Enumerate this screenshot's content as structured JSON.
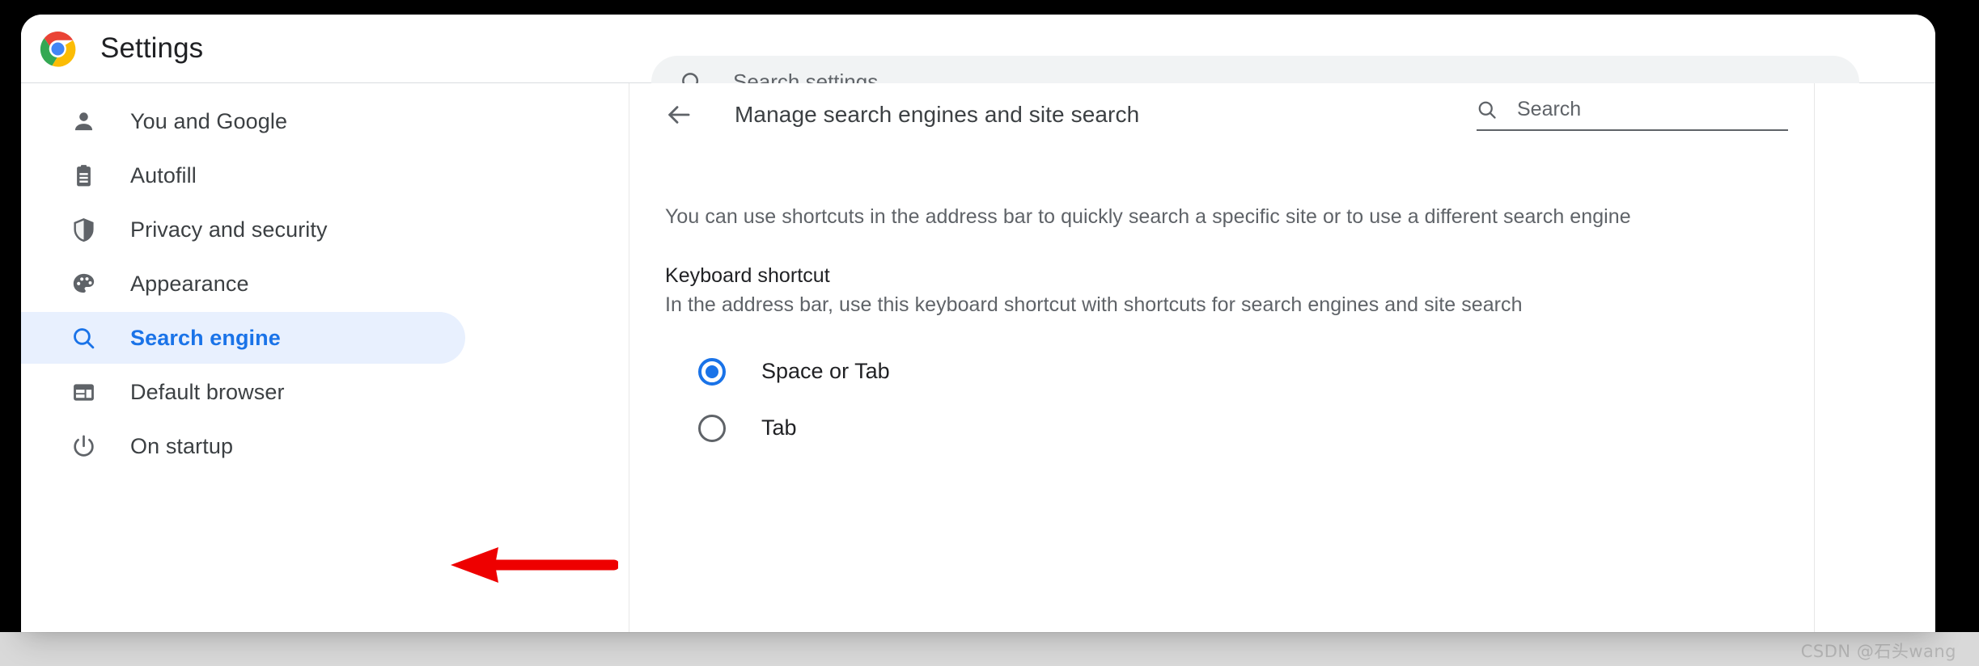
{
  "header": {
    "logo_icon": "chrome-logo-icon",
    "title": "Settings",
    "search": {
      "icon": "search-icon",
      "placeholder": "Search settings",
      "value": ""
    }
  },
  "sidebar": {
    "items": [
      {
        "label": "You and Google",
        "icon": "person-icon",
        "selected": false
      },
      {
        "label": "Autofill",
        "icon": "clipboard-icon",
        "selected": false
      },
      {
        "label": "Privacy and security",
        "icon": "shield-icon",
        "selected": false
      },
      {
        "label": "Appearance",
        "icon": "palette-icon",
        "selected": false
      },
      {
        "label": "Search engine",
        "icon": "search-icon",
        "selected": true
      },
      {
        "label": "Default browser",
        "icon": "browser-window-icon",
        "selected": false
      },
      {
        "label": "On startup",
        "icon": "power-icon",
        "selected": false
      }
    ]
  },
  "content": {
    "back_icon": "arrow-left-icon",
    "title": "Manage search engines and site search",
    "search": {
      "icon": "search-icon",
      "placeholder": "Search",
      "value": ""
    },
    "intro": "You can use shortcuts in the address bar to quickly search a specific site or to use a different search engine",
    "section": {
      "title": "Keyboard shortcut",
      "description": "In the address bar, use this keyboard shortcut with shortcuts for search engines and site search",
      "options": [
        {
          "label": "Space or Tab",
          "checked": true
        },
        {
          "label": "Tab",
          "checked": false
        }
      ]
    }
  },
  "annotation": {
    "arrow_icon": "red-arrow-left-icon",
    "arrow_color": "#ee0000"
  },
  "watermark": "CSDN @石头wang",
  "colors": {
    "accent_blue": "#1a73e8",
    "selected_row_bg": "#e8f0fe",
    "text_primary": "#202124",
    "text_secondary": "#5f6368",
    "searchbar_bg": "#f1f3f4",
    "annotation_red": "#ee0000"
  }
}
